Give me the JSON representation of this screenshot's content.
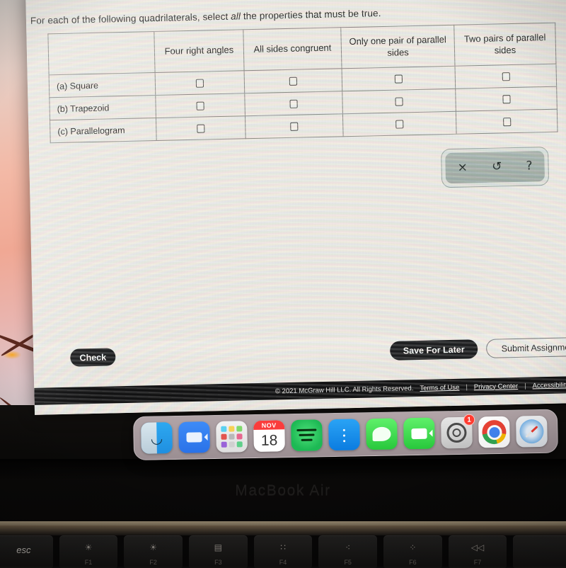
{
  "prompt": {
    "before": "For each of the following quadrilaterals, select ",
    "emphasis": "all",
    "after": " the properties that must be true."
  },
  "table": {
    "corner_header": "",
    "headers": [
      "Four right angles",
      "All sides congruent",
      "Only one pair of parallel sides",
      "Two pairs of parallel sides"
    ],
    "rows": [
      {
        "label": "(a) Square",
        "checked": [
          false,
          false,
          false,
          false
        ]
      },
      {
        "label": "(b) Trapezoid",
        "checked": [
          false,
          false,
          false,
          false
        ]
      },
      {
        "label": "(c) Parallelogram",
        "checked": [
          false,
          false,
          false,
          false
        ]
      }
    ]
  },
  "toolbar": {
    "clear": "×",
    "undo": "↺",
    "help": "?"
  },
  "actions": {
    "check": "Check",
    "save_for_later": "Save For Later",
    "submit_assignment": "Submit Assignment"
  },
  "legal": {
    "copyright": "© 2021 McGraw Hill LLC. All Rights Reserved.",
    "terms": "Terms of Use",
    "privacy": "Privacy Center",
    "accessibility": "Accessibility",
    "separator": "|"
  },
  "dock": {
    "items": [
      {
        "name": "finder",
        "label": "Finder"
      },
      {
        "name": "zoom",
        "label": "Zoom"
      },
      {
        "name": "launchpad",
        "label": "Launchpad"
      },
      {
        "name": "calendar",
        "label": "Calendar",
        "month": "NOV",
        "day": "18"
      },
      {
        "name": "spotify",
        "label": "Spotify"
      },
      {
        "name": "app-store",
        "label": "App Store"
      },
      {
        "name": "messages",
        "label": "Messages"
      },
      {
        "name": "facetime",
        "label": "FaceTime"
      },
      {
        "name": "system-preferences",
        "label": "System Preferences",
        "badge": "1"
      },
      {
        "name": "chrome",
        "label": "Google Chrome"
      },
      {
        "name": "safari",
        "label": "Safari"
      }
    ]
  },
  "device": {
    "model_label": "MacBook Air",
    "keys": [
      {
        "glyph": "esc",
        "label": ""
      },
      {
        "glyph": "☀",
        "label": "F1"
      },
      {
        "glyph": "☀",
        "label": "F2"
      },
      {
        "glyph": "▤",
        "label": "F3"
      },
      {
        "glyph": "∷",
        "label": "F4"
      },
      {
        "glyph": "⁖",
        "label": "F5"
      },
      {
        "glyph": "⁘",
        "label": "F6"
      },
      {
        "glyph": "◁◁",
        "label": "F7"
      },
      {
        "glyph": "",
        "label": ""
      }
    ]
  },
  "colors": {
    "page_bg": "#eceae5",
    "table_border": "#8a8a88",
    "button_dark": "#17181a",
    "legal_bar": "#0b0b0c",
    "toolbar_bg": "#a9b6b2",
    "badge_red": "#ff3b30"
  }
}
